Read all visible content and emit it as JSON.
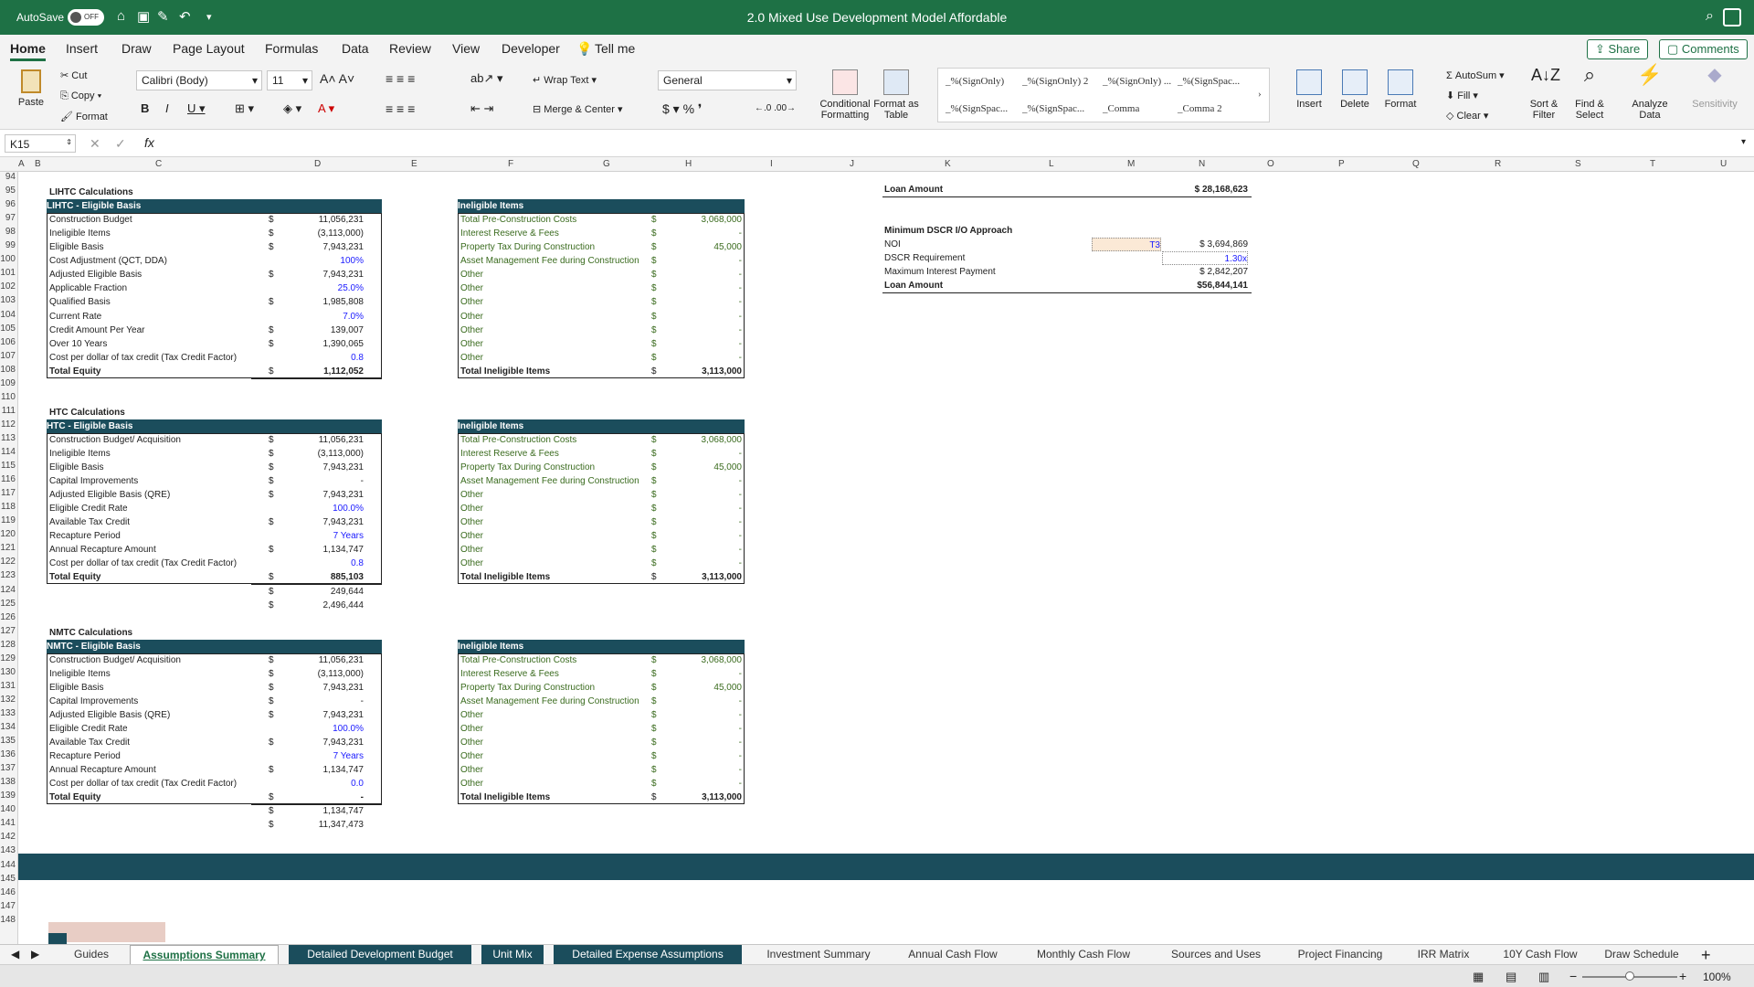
{
  "titlebar": {
    "autosave": "AutoSave",
    "toggle": "OFF",
    "doc_title": "2.0 Mixed Use Development Model Affordable"
  },
  "tabs": [
    "Home",
    "Insert",
    "Draw",
    "Page Layout",
    "Formulas",
    "Data",
    "Review",
    "View",
    "Developer",
    "Tell me"
  ],
  "share": "Share",
  "comments": "Comments",
  "ribbon": {
    "paste": "Paste",
    "cut": "Cut",
    "copy": "Copy",
    "format": "Format",
    "font": "Calibri (Body)",
    "size": "11",
    "wrap": "Wrap Text",
    "merge": "Merge & Center",
    "numfmt": "General",
    "cond": "Conditional Formatting",
    "fmt_table": "Format as Table",
    "styles": [
      "_%(SignOnly)",
      "_%(SignOnly) 2",
      "_%(SignOnly) ...",
      "_%(SignSpac...",
      "_%(SignSpac...",
      "_%(SignSpac...",
      "_Comma",
      "_Comma 2"
    ],
    "insert": "Insert",
    "delete": "Delete",
    "format_cells": "Format",
    "autosum": "AutoSum",
    "fill": "Fill",
    "clear": "Clear",
    "sort": "Sort & Filter",
    "find": "Find & Select",
    "analyze": "Analyze Data",
    "sensitivity": "Sensitivity"
  },
  "formula": {
    "namebox": "K15",
    "fx": "fx",
    "value": ""
  },
  "columns": [
    "A",
    "B",
    "C",
    "D",
    "E",
    "F",
    "G",
    "H",
    "I",
    "J",
    "K",
    "L",
    "M",
    "N",
    "O",
    "P",
    "Q",
    "R",
    "S",
    "T",
    "U"
  ],
  "rows": [
    "94",
    "95",
    "96",
    "97",
    "98",
    "99",
    "100",
    "101",
    "102",
    "103",
    "104",
    "105",
    "106",
    "107",
    "108",
    "109",
    "110",
    "111",
    "112",
    "113",
    "114",
    "115",
    "116",
    "117",
    "118",
    "119",
    "120",
    "121",
    "122",
    "123",
    "124",
    "125",
    "126",
    "127",
    "128",
    "129",
    "130",
    "131",
    "132",
    "133",
    "134",
    "135",
    "136",
    "137",
    "138",
    "139",
    "140",
    "141",
    "142",
    "143",
    "144",
    "145",
    "146",
    "147",
    "148"
  ],
  "lihtc": {
    "title": "LIHTC Calculations",
    "header": "LIHTC - Eligible Basis",
    "rows": [
      [
        "Construction Budget",
        "$",
        "11,056,231"
      ],
      [
        "Ineligible Items",
        "$",
        "(3,113,000)"
      ],
      [
        "Eligible Basis",
        "$",
        "7,943,231"
      ],
      [
        "Cost Adjustment (QCT, DDA)",
        "",
        "100%"
      ],
      [
        "Adjusted Eligible Basis",
        "$",
        "7,943,231"
      ],
      [
        "Applicable Fraction",
        "",
        "25.0%"
      ],
      [
        "Qualified Basis",
        "$",
        "1,985,808"
      ],
      [
        "Current Rate",
        "",
        "7.0%"
      ],
      [
        "Credit Amount Per Year",
        "$",
        "139,007"
      ],
      [
        "Over 10 Years",
        "$",
        "1,390,065"
      ],
      [
        "Cost per dollar of tax credit (Tax Credit Factor)",
        "",
        "0.8"
      ]
    ],
    "total": [
      "Total Equity",
      "$",
      "1,112,052"
    ]
  },
  "htc": {
    "title": "HTC Calculations",
    "header": "HTC - Eligible Basis",
    "rows": [
      [
        "Construction Budget/ Acquisition",
        "$",
        "11,056,231"
      ],
      [
        "Ineligible Items",
        "$",
        "(3,113,000)"
      ],
      [
        "Eligible Basis",
        "$",
        "7,943,231"
      ],
      [
        "Capital Improvements",
        "$",
        "-"
      ],
      [
        "Adjusted Eligible Basis (QRE)",
        "$",
        "7,943,231"
      ],
      [
        "Eligible Credit Rate",
        "",
        "100.0%"
      ],
      [
        "Available Tax Credit",
        "$",
        "7,943,231"
      ],
      [
        "Recapture Period",
        "",
        "7 Years"
      ],
      [
        "Annual Recapture Amount",
        "$",
        "1,134,747"
      ],
      [
        "Cost per dollar of tax credit (Tax Credit Factor)",
        "",
        "0.8"
      ]
    ],
    "total": [
      "Total Equity",
      "$",
      "885,103"
    ],
    "extra": [
      [
        "$",
        "249,644"
      ],
      [
        "$",
        "2,496,444"
      ]
    ]
  },
  "nmtc": {
    "title": "NMTC Calculations",
    "header": "NMTC - Eligible Basis",
    "rows": [
      [
        "Construction Budget/ Acquisition",
        "$",
        "11,056,231"
      ],
      [
        "Ineligible Items",
        "$",
        "(3,113,000)"
      ],
      [
        "Eligible Basis",
        "$",
        "7,943,231"
      ],
      [
        "Capital Improvements",
        "$",
        "-"
      ],
      [
        "Adjusted Eligible Basis (QRE)",
        "$",
        "7,943,231"
      ],
      [
        "Eligible Credit Rate",
        "",
        "100.0%"
      ],
      [
        "Available Tax Credit",
        "$",
        "7,943,231"
      ],
      [
        "Recapture Period",
        "",
        "7 Years"
      ],
      [
        "Annual Recapture Amount",
        "$",
        "1,134,747"
      ],
      [
        "Cost per dollar of tax credit (Tax Credit Factor)",
        "",
        "0.0"
      ]
    ],
    "total": [
      "Total Equity",
      "$",
      "-"
    ],
    "extra": [
      [
        "$",
        "1,134,747"
      ],
      [
        "$",
        "11,347,473"
      ]
    ]
  },
  "ineligible": {
    "header": "Ineligible Items",
    "rows": [
      [
        "Total Pre-Construction Costs",
        "$",
        "3,068,000"
      ],
      [
        "Interest Reserve & Fees",
        "$",
        "-"
      ],
      [
        "Property Tax During Construction",
        "$",
        "45,000"
      ],
      [
        "Asset Management Fee during Construction",
        "$",
        "-"
      ],
      [
        "Other",
        "$",
        "-"
      ],
      [
        "Other",
        "$",
        "-"
      ],
      [
        "Other",
        "$",
        "-"
      ],
      [
        "Other",
        "$",
        "-"
      ],
      [
        "Other",
        "$",
        "-"
      ],
      [
        "Other",
        "$",
        "-"
      ],
      [
        "Other",
        "$",
        "-"
      ]
    ],
    "total": [
      "Total Ineligible Items",
      "$",
      "3,113,000"
    ]
  },
  "loan": {
    "loan_amount_label": "Loan Amount",
    "loan_amount": "$ 28,168,623",
    "dscr_title": "Minimum DSCR I/O Approach",
    "noi_label": "NOI",
    "noi_tag": "T3",
    "noi_value": "$   3,694,869",
    "dscr_label": "DSCR Requirement",
    "dscr_value": "1.30x",
    "maxint_label": "Maximum Interest Payment",
    "maxint_value": "$   2,842,207",
    "loan2_label": "Loan Amount",
    "loan2_value": "$56,844,141"
  },
  "sheets": [
    "Guides",
    "Assumptions Summary",
    "Detailed Development Budget",
    "Unit Mix",
    "Detailed Expense Assumptions",
    "Investment Summary",
    "Annual Cash Flow",
    "Monthly Cash Flow",
    "Sources and Uses",
    "Project Financing",
    "IRR Matrix",
    "10Y Cash Flow",
    "Draw Schedule"
  ],
  "status": {
    "zoom": "100%"
  }
}
